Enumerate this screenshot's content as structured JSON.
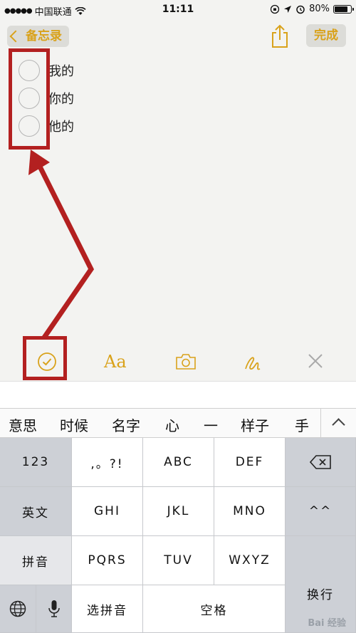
{
  "status_bar": {
    "carrier": "中国联通",
    "time": "11:11",
    "battery": "80%",
    "battery_level": 0.8
  },
  "nav": {
    "back_label": "备忘录",
    "done_label": "完成",
    "share_icon": "share-icon"
  },
  "note": {
    "checklist": [
      {
        "text": "我的",
        "checked": false
      },
      {
        "text": "你的",
        "checked": false
      },
      {
        "text": "他的",
        "checked": false
      }
    ]
  },
  "toolbar": {
    "items": [
      "checklist-icon",
      "text-format-icon",
      "camera-icon",
      "sketch-icon",
      "close-icon"
    ],
    "format_label": "Aa"
  },
  "candidates": [
    "意思",
    "时候",
    "名字",
    "心",
    "一",
    "样子",
    "手"
  ],
  "keyboard": {
    "row1": [
      "123",
      ",。?!",
      "ABC",
      "DEF"
    ],
    "row2": [
      "英文",
      "GHI",
      "JKL",
      "MNO",
      "^^"
    ],
    "row3": [
      "拼音",
      "PQRS",
      "TUV",
      "WXYZ"
    ],
    "row4": [
      "选拼音",
      "空格"
    ],
    "return_label": "换行"
  },
  "watermark": "Bai 经验",
  "colors": {
    "accent": "#d9a21b",
    "annotation": "#b32020",
    "paper": "#f3f3f1"
  }
}
